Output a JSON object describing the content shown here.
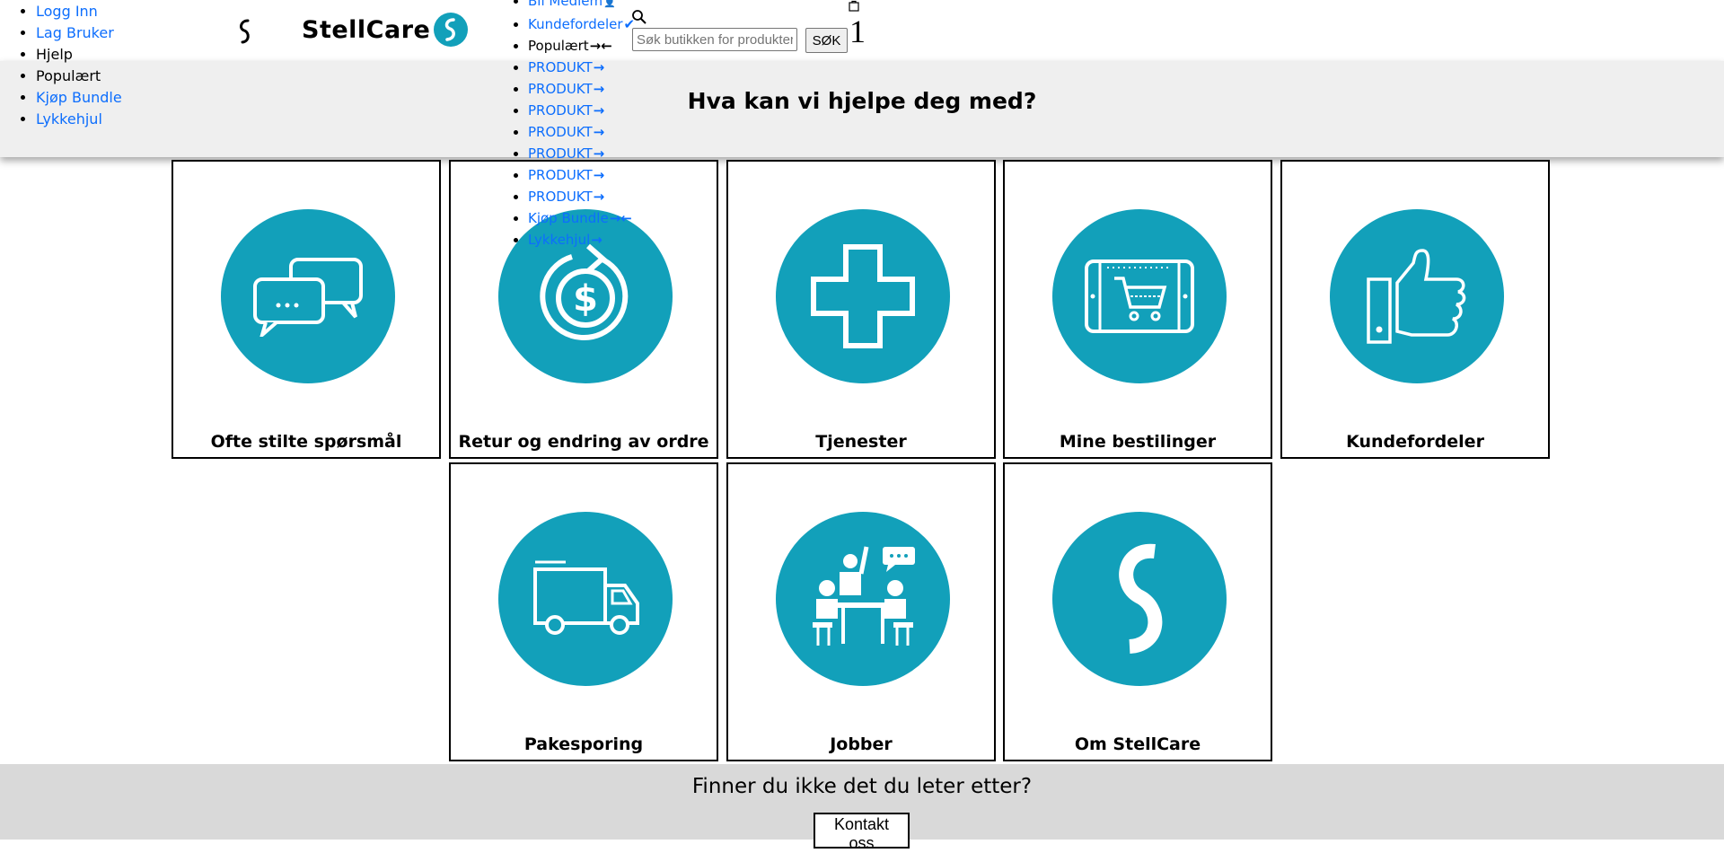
{
  "account_menu": [
    "Logg Inn",
    "Lag Bruker",
    "Hjelp",
    "Populært",
    "Kjøp Bundle",
    "Lykkehjul"
  ],
  "brand": {
    "name": "StellCare"
  },
  "main_menu": {
    "items": [
      {
        "label": "Bli Medlem",
        "icon": "person-icon"
      },
      {
        "label": "Kundefordeler",
        "icon": "check-icon"
      },
      {
        "label": "Populært",
        "icon": "arrow-right-left-icon"
      },
      {
        "label": "PRODUKT",
        "icon": "arrow-right-icon"
      },
      {
        "label": "PRODUKT",
        "icon": "arrow-right-icon"
      },
      {
        "label": "PRODUKT",
        "icon": "arrow-right-icon"
      },
      {
        "label": "PRODUKT",
        "icon": "arrow-right-icon"
      },
      {
        "label": "PRODUKT",
        "icon": "arrow-right-icon"
      },
      {
        "label": "PRODUKT",
        "icon": "arrow-right-icon"
      },
      {
        "label": "PRODUKT",
        "icon": "arrow-right-icon"
      },
      {
        "label": "Kjøp Bundle",
        "icon": "arrow-right-left-icon"
      },
      {
        "label": "Lykkehjul",
        "icon": "arrow-right-icon"
      }
    ]
  },
  "search": {
    "placeholder": "Søk butikken for produkter",
    "button_label": "SØK"
  },
  "cart": {
    "count": "1"
  },
  "hero": {
    "title": "Hva kan vi hjelpe deg med?"
  },
  "tiles": [
    {
      "label": "Ofte stilte spørsmål",
      "icon": "chat-bubbles-icon"
    },
    {
      "label": "Retur og endring av ordre",
      "icon": "refund-dollar-icon"
    },
    {
      "label": "Tjenester",
      "icon": "medical-cross-icon"
    },
    {
      "label": "Mine bestilinger",
      "icon": "tablet-cart-icon"
    },
    {
      "label": "Kundefordeler",
      "icon": "thumbs-up-icon"
    },
    {
      "label": "Pakesporing",
      "icon": "delivery-truck-icon"
    },
    {
      "label": "Jobber",
      "icon": "meeting-people-icon"
    },
    {
      "label": "Om StellCare",
      "icon": "stellcare-logo-icon"
    }
  ],
  "contact": {
    "text": "Finner du ikke det du leter etter?",
    "button_label": "Kontakt oss"
  },
  "colors": {
    "accent": "#12a0ba",
    "link": "#0d6efd",
    "hero_bg": "#efefef",
    "contact_bg": "#d9d9d9"
  }
}
